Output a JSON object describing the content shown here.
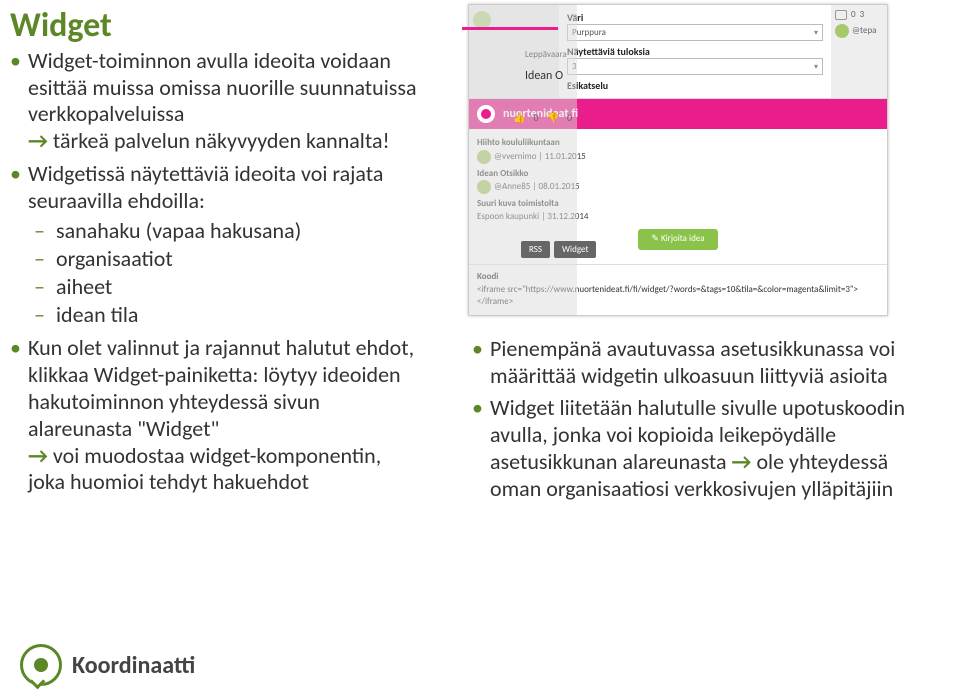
{
  "title": "Widget",
  "left": {
    "b1_text": "Widget-toiminnon avulla ideoita voidaan esittää muissa omissa nuorille suunnatuissa verkkopalveluissa",
    "b1_arrow": "→",
    "b1_tail": "tärkeä palvelun näkyvyyden kannalta!",
    "b2_text": "Widgetissä näytettäviä ideoita voi rajata seuraavilla ehdoilla:",
    "sub": [
      "sanahaku (vapaa hakusana)",
      "organisaatiot",
      "aiheet",
      "idean tila"
    ],
    "b3_text": "Kun olet valinnut ja rajannut halutut ehdot, klikkaa Widget-painiketta: löytyy ideoiden hakutoiminnon yhteydessä sivun alareunasta \"Widget\"",
    "b3_arrow": "→",
    "b3_tail": "voi muodostaa widget-komponentin, joka huomioi tehdyt hakuehdot"
  },
  "logo": {
    "text": "Koordinaatti"
  },
  "shot": {
    "vari_label": "Väri",
    "vari_value": "Purppura",
    "nayt_label": "Näytettäviä tuloksia",
    "nayt_value": "3",
    "esikatselu": "Esikatselu",
    "brand": "nuortenideat.fi",
    "leppavaara": "Leppävaara",
    "idean_o": "Idean O",
    "thumbs_up": "0",
    "thumbs_down": "0",
    "right0": "0",
    "right3": "3",
    "right_at": "@tepa",
    "items": [
      {
        "t": "Hiihto koululiikuntaan",
        "u": "@vvernimo | 11.01.2015"
      },
      {
        "t": "Idean Otsikko",
        "u": "@Anne85 | 08.01.2015"
      },
      {
        "t": "Suuri kuva toimistolta",
        "u": "Espoon kaupunki | 31.12.2014"
      }
    ],
    "btn": "Kirjoita idea",
    "koodi_label": "Koodi",
    "code": "<iframe src=\"https://www.nuortenideat.fi/fi/widget/?words=&tags=10&tila=&color=magenta&limit=3\"></iframe>",
    "rss": "RSS",
    "widget_btn": "Widget"
  },
  "right_bullets": {
    "b1": "Pienempänä avautuvassa asetusikkunassa voi määrittää widgetin ulkoasuun liittyviä asioita",
    "b2_a": "Widget liitetään halutulle sivulle upotuskoodin avulla, jonka voi kopioida leikepöydälle asetusikkunan alareunasta ",
    "b2_arrow": "→",
    "b2_b": " ole yhteydessä oman organisaatiosi verkkosivujen ylläpitäjiin"
  }
}
